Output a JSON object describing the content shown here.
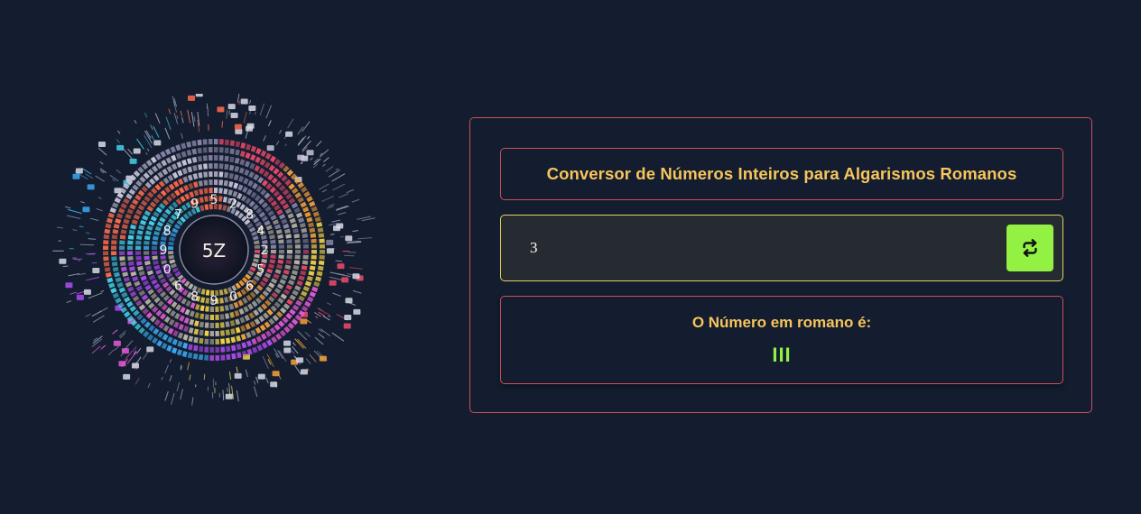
{
  "art": {
    "center_text": "5Z"
  },
  "converter": {
    "title": "Conversor de Números Inteiros para Algarismos Romanos",
    "input_value": "3",
    "button_icon": "repeat-icon",
    "result_label": "O Número em romano é:",
    "result_value": "III"
  },
  "colors": {
    "background": "#131d2f",
    "border_red": "#c9505a",
    "border_yellow": "#e3cf5a",
    "title_gold": "#f7c55a",
    "accent_green": "#93f144",
    "input_bg": "#262a31"
  }
}
